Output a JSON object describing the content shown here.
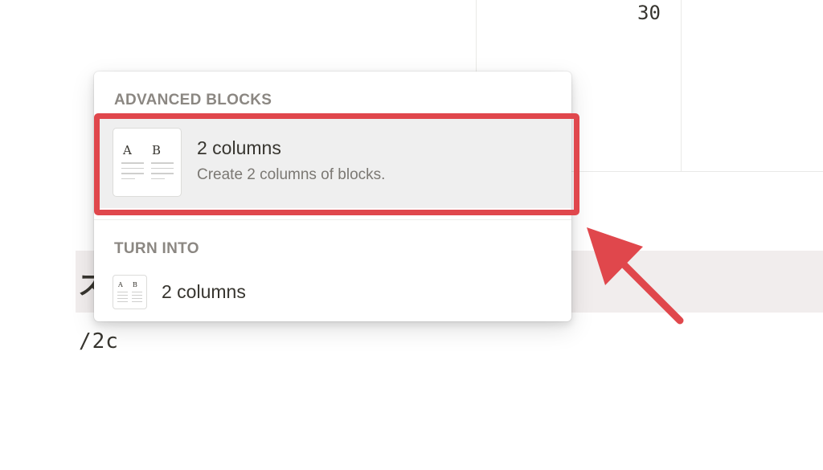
{
  "background": {
    "table_cell_value": "30",
    "heading_glyph": "ス",
    "slash_command": "/2c"
  },
  "popup": {
    "advanced_section": {
      "header": "ADVANCED BLOCKS",
      "item": {
        "title": "2 columns",
        "description": "Create 2 columns of blocks.",
        "thumb_left_letter": "A",
        "thumb_right_letter": "B",
        "highlighted": true
      }
    },
    "turn_into_section": {
      "header": "TURN INTO",
      "item": {
        "title": "2 columns",
        "thumb_left_letter": "A",
        "thumb_right_letter": "B"
      }
    }
  },
  "annotation": {
    "box_color": "#e0474c",
    "arrow_color": "#e0474c",
    "arrow_icon": "arrow-up-left-icon"
  },
  "colors": {
    "menu_highlight_bg": "#efefef",
    "heading_band_bg": "#f1eded",
    "section_header_text": "#8b8782"
  }
}
